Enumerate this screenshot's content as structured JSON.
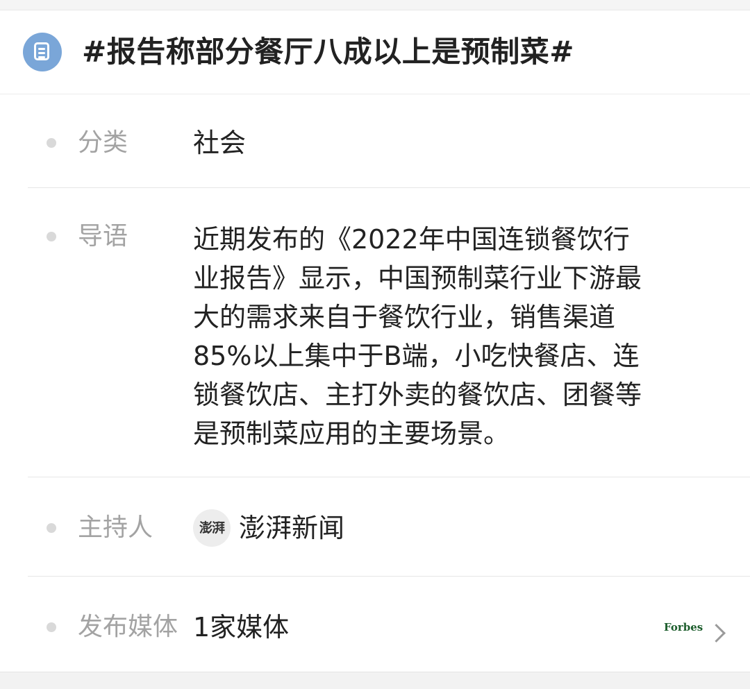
{
  "topic": {
    "title": "#报告称部分餐厅八成以上是预制菜#",
    "icon": "document-list-icon",
    "icon_color": "#7aa6d8"
  },
  "details": {
    "category": {
      "label": "分类",
      "value": "社会"
    },
    "lead": {
      "label": "导语",
      "value": "近期发布的《2022年中国连锁餐饮行\n业报告》显示，中国预制菜行业下游最\n大的需求来自于餐饮行业，销售渠道\n85%以上集中于B端，小吃快餐店、连\n锁餐饮店、主打外卖的餐饮店、团餐等\n是预制菜应用的主要场景。"
    },
    "host": {
      "label": "主持人",
      "avatar_text": "澎湃",
      "value": "澎湃新闻"
    },
    "media": {
      "label": "发布媒体",
      "value": "1家媒体",
      "logo_text": "Forbes",
      "chevron": "chevron-right-icon"
    }
  },
  "colors": {
    "label": "#a3a3a3",
    "text": "#222222",
    "bullet": "#d9d9d9",
    "forbes": "#1c5d2c"
  }
}
